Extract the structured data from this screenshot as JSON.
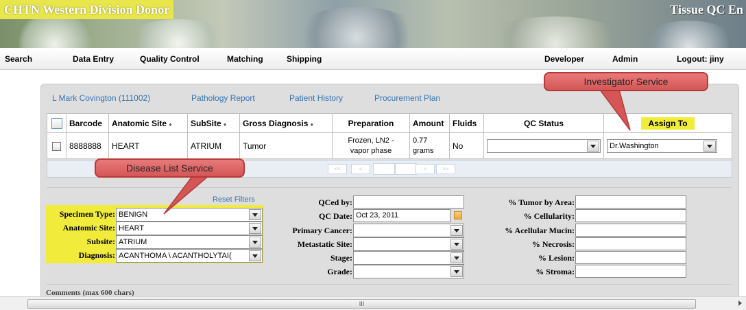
{
  "header": {
    "title": "CHTN Western Division Donor",
    "right_title": "Tissue QC En"
  },
  "nav": {
    "items": [
      "Search",
      "Data Entry",
      "Quality Control",
      "Matching",
      "Shipping"
    ],
    "developer": "Developer",
    "admin": "Admin",
    "logout": "Logout: jiny"
  },
  "subnav": {
    "links": [
      "L Mark Covington (111002)",
      "Pathology Report",
      "Patient History",
      "Procurement Plan"
    ]
  },
  "table": {
    "headers": [
      "Barcode",
      "Anatomic Site",
      "SubSite",
      "Gross Diagnosis",
      "Preparation",
      "Amount",
      "Fluids",
      "QC Status",
      "Assign To"
    ],
    "sort_indicator": "♦",
    "row": {
      "barcode": "8888888",
      "anatomic_site": "HEART",
      "subsite": "ATRIUM",
      "gross_diagnosis": "Tumor",
      "preparation_line1": "Frozen, LN2 -",
      "preparation_line2": "vapor phase",
      "amount_line1": "0.77",
      "amount_line2": "grams",
      "fluids": "No",
      "qc_status": "",
      "assign_to": "Dr.Washington"
    }
  },
  "pager": {
    "first": "<<",
    "prev": "<",
    "next": ">",
    "last": ">>"
  },
  "filters": {
    "reset": "Reset Filters",
    "specimen_type_label": "Specimen Type:",
    "specimen_type": "BENIGN",
    "anatomic_site_label": "Anatomic Site:",
    "anatomic_site": "HEART",
    "subsite_label": "Subsite:",
    "subsite": "ATRIUM",
    "diagnosis_label": "Diagnosis:",
    "diagnosis": "ACANTHOMA \\ ACANTHOLYTAI("
  },
  "qc": {
    "qced_by_label": "QCed by:",
    "qced_by": "",
    "qc_date_label": "QC Date:",
    "qc_date": "Oct 23, 2011",
    "primary_cancer_label": "Primary Cancer:",
    "metastatic_site_label": "Metastatic Site:",
    "stage_label": "Stage:",
    "grade_label": "Grade:"
  },
  "percent": {
    "tumor_label": "% Tumor by Area:",
    "cellularity_label": "% Cellularity:",
    "acellular_label": "% Acellular Mucin:",
    "necrosis_label": "% Necrosis:",
    "lesion_label": "% Lesion:",
    "stroma_label": "% Stroma:"
  },
  "comments_label": "Comments (max 600 chars)",
  "callouts": {
    "investigator": "Investigator Service",
    "disease": "Disease List Service"
  },
  "scrollbar_grip": "III",
  "colors": {
    "highlight": "#f1ec3c",
    "callout": "#d45656",
    "link": "#3575b5"
  }
}
